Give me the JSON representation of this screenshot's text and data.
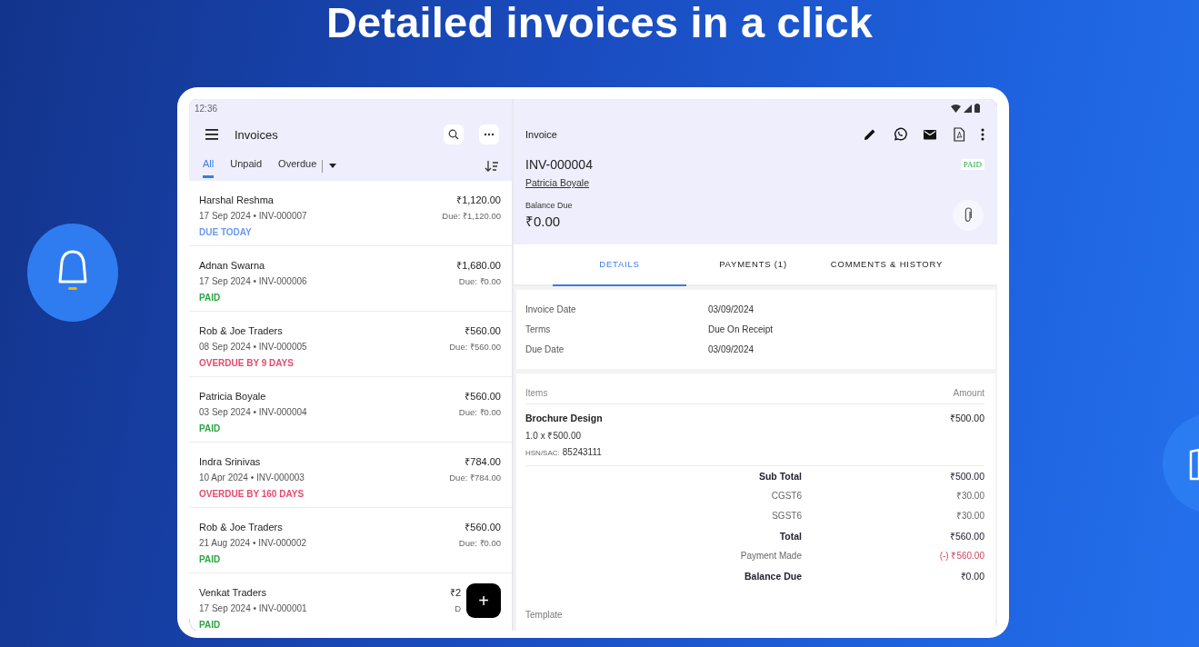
{
  "headline": "Detailed invoices in a click",
  "status_bar": {
    "time": "12:36"
  },
  "list_panel": {
    "title": "Invoices",
    "filters": [
      {
        "label": "All",
        "selected": true
      },
      {
        "label": "Unpaid",
        "selected": false
      },
      {
        "label": "Overdue",
        "selected": false
      }
    ],
    "invoices": [
      {
        "customer": "Harshal Reshma",
        "meta": "17 Sep 2024 • INV-000007",
        "amount": "₹1,120.00",
        "due": "Due: ₹1,120.00",
        "status": "DUE TODAY",
        "color": "#6a9be8"
      },
      {
        "customer": "Adnan Swarna",
        "meta": "17 Sep 2024 • INV-000006",
        "amount": "₹1,680.00",
        "due": "Due: ₹0.00",
        "status": "PAID",
        "color": "#2aa541"
      },
      {
        "customer": "Rob & Joe Traders",
        "meta": "08 Sep 2024 • INV-000005",
        "amount": "₹560.00",
        "due": "Due: ₹560.00",
        "status": "OVERDUE BY 9 DAYS",
        "color": "#e54b6d"
      },
      {
        "customer": "Patricia Boyale",
        "meta": "03 Sep 2024 • INV-000004",
        "amount": "₹560.00",
        "due": "Due: ₹0.00",
        "status": "PAID",
        "color": "#2aa541"
      },
      {
        "customer": "Indra Srinivas",
        "meta": "10 Apr 2024 • INV-000003",
        "amount": "₹784.00",
        "due": "Due: ₹784.00",
        "status": "OVERDUE BY 160 DAYS",
        "color": "#e54b6d"
      },
      {
        "customer": "Rob & Joe Traders",
        "meta": "21 Aug 2024 • INV-000002",
        "amount": "₹560.00",
        "due": "Due: ₹0.00",
        "status": "PAID",
        "color": "#2aa541"
      },
      {
        "customer": "Venkat Traders",
        "meta": "17 Sep 2024 • INV-000001",
        "amount": "₹2",
        "due": "D",
        "status": "PAID",
        "color": "#2aa541"
      }
    ],
    "fab": "+"
  },
  "detail": {
    "title": "Invoice",
    "number": "INV-000004",
    "status": "PAID",
    "customer": "Patricia Boyale",
    "balance_label": "Balance Due",
    "balance": "₹0.00",
    "tabs": [
      {
        "label": "DETAILS",
        "selected": true
      },
      {
        "label": "PAYMENTS (1)",
        "selected": false
      },
      {
        "label": "COMMENTS & HISTORY",
        "selected": false
      }
    ],
    "fields": [
      {
        "label": "Invoice Date",
        "value": "03/09/2024"
      },
      {
        "label": "Terms",
        "value": "Due On Receipt"
      },
      {
        "label": "Due Date",
        "value": "03/09/2024"
      }
    ],
    "items_header": {
      "items": "Items",
      "amount": "Amount"
    },
    "items": [
      {
        "name": "Brochure Design",
        "amount": "₹500.00",
        "quantity_line": "1.0 x ₹500.00",
        "hsn_label": "HSN/SAC:",
        "hsn": "85243111"
      }
    ],
    "totals": [
      {
        "label": "Sub Total",
        "value": "₹500.00",
        "kind": "bold"
      },
      {
        "label": "CGST6",
        "value": "₹30.00",
        "kind": "plain"
      },
      {
        "label": "SGST6",
        "value": "₹30.00",
        "kind": "plain"
      },
      {
        "label": "Total",
        "value": "₹560.00",
        "kind": "bold"
      },
      {
        "label": "Payment Made",
        "value": "(-) ₹560.00",
        "kind": "deduction"
      },
      {
        "label": "Balance Due",
        "value": "₹0.00",
        "kind": "bold"
      }
    ],
    "template_label": "Template"
  }
}
